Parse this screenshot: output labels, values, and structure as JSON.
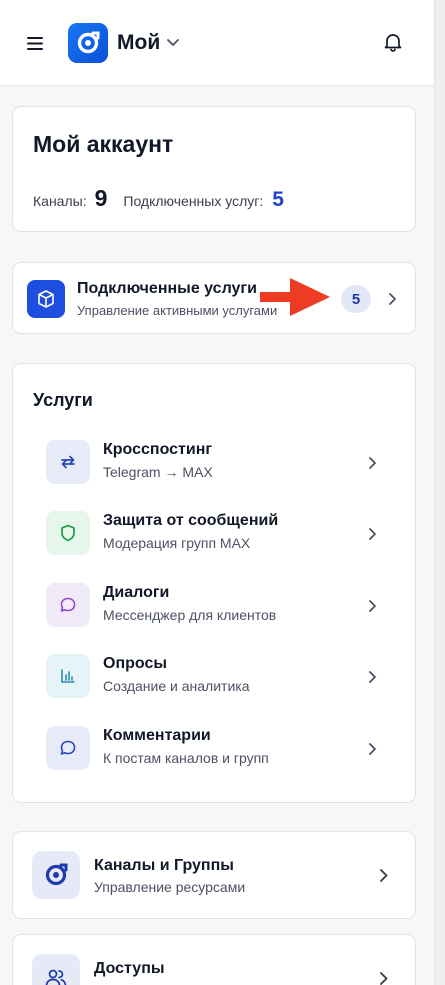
{
  "header": {
    "app_name": "Мой",
    "icons": {
      "menu": "hamburger-icon",
      "logo": "app-logo-icon",
      "dropdown": "chevron-down-icon",
      "notifications": "bell-icon"
    }
  },
  "account": {
    "title": "Мой аккаунт",
    "channels_label": "Каналы:",
    "channels_value": "9",
    "services_label": "Подключенных услуг:",
    "services_value": "5"
  },
  "connected": {
    "title": "Подключенные услуги",
    "subtitle": "Управление активными услугами",
    "badge": "5",
    "icon": "box-icon"
  },
  "services": {
    "title": "Услуги",
    "items": [
      {
        "title": "Кросспостинг",
        "subtitle": "Telegram → MAX",
        "icon": "repeat-arrows-icon",
        "bg": "#e7ebf8",
        "color": "#2b47b8"
      },
      {
        "title": "Защита от сообщений",
        "subtitle": "Модерация групп MAX",
        "icon": "shield-icon",
        "bg": "#e6f6ea",
        "color": "#1f9d4a"
      },
      {
        "title": "Диалоги",
        "subtitle": "Мессенджер для клиентов",
        "icon": "chat-bubble-icon",
        "bg": "#f1eaf8",
        "color": "#8b4bd0"
      },
      {
        "title": "Опросы",
        "subtitle": "Создание и аналитика",
        "icon": "bar-chart-icon",
        "bg": "#e6f4f8",
        "color": "#2a8fb0"
      },
      {
        "title": "Комментарии",
        "subtitle": "К постам каналов и групп",
        "icon": "comment-icon",
        "bg": "#e7ebf8",
        "color": "#2b47b8"
      }
    ]
  },
  "channels_groups": {
    "title": "Каналы и Группы",
    "subtitle": "Управление ресурсами",
    "icon": "app-logo-icon"
  },
  "access": {
    "title": "Доступы",
    "icon": "users-icon"
  },
  "colors": {
    "accent": "#1d4ee0",
    "annotation_arrow": "#ee3b24"
  }
}
